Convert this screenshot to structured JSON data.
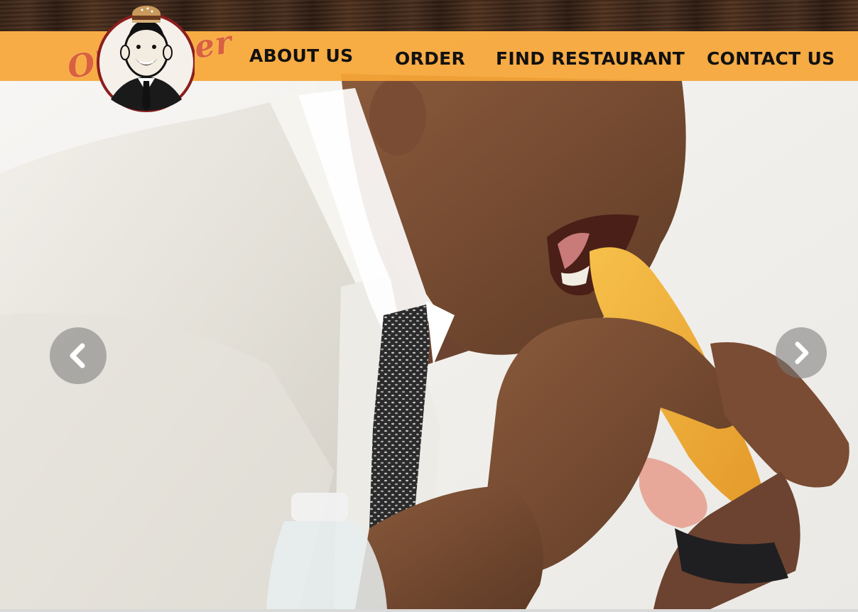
{
  "brand": {
    "logo_text": "O'Burger",
    "logo_icon": "burger-man-emblem-icon"
  },
  "nav": {
    "items": [
      {
        "label": "ABOUT US"
      },
      {
        "label": "ORDER"
      },
      {
        "label": "FIND RESTAURANT"
      },
      {
        "label": "CONTACT US"
      }
    ]
  },
  "carousel": {
    "prev_icon": "chevron-left-icon",
    "next_icon": "chevron-right-icon",
    "slide_image": "man-eating-sandwich-photo"
  },
  "colors": {
    "nav_bar": "#f6a637",
    "nav_text": "#111111",
    "logo_text": "#d96040",
    "header_wood": "#3a2418",
    "arrow_bg": "#787878"
  }
}
